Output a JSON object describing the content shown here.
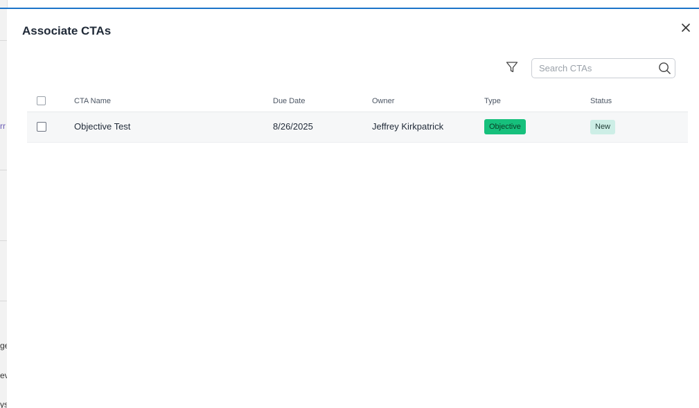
{
  "background": {
    "fragments": [
      "rr",
      "ge",
      "ev",
      "ys"
    ]
  },
  "modal": {
    "title": "Associate CTAs",
    "search": {
      "placeholder": "Search CTAs",
      "value": ""
    },
    "table": {
      "columns": [
        "CTA Name",
        "Due Date",
        "Owner",
        "Type",
        "Status"
      ],
      "rows": [
        {
          "name": "Objective Test",
          "due_date": "8/26/2025",
          "owner": "Jeffrey Kirkpatrick",
          "type": "Objective",
          "status": "New",
          "selected": false
        }
      ]
    }
  },
  "colors": {
    "accent": "#1a73c9",
    "type_badge": "#16c07c",
    "status_badge": "#cdeee6"
  },
  "icons": [
    "close-icon",
    "filter-icon",
    "search-icon"
  ]
}
